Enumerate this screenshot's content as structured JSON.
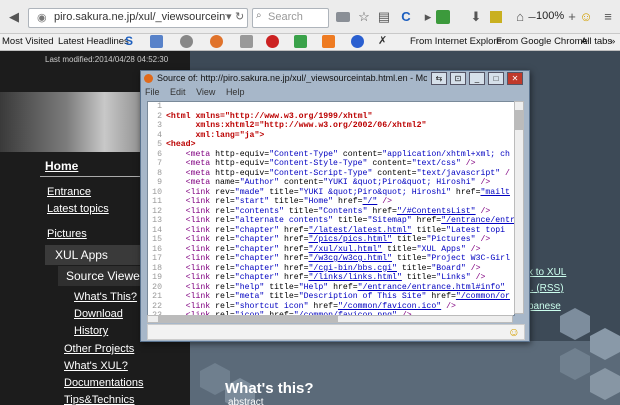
{
  "browser": {
    "url": "piro.sakura.ne.jp/xul/_viewsourceintab.html.e",
    "search_placeholder": "Search",
    "zoom": "100%",
    "bookmarks": [
      "Most Visited",
      "Latest Headlines",
      "From Internet Explorer",
      "From Google Chrome",
      "All tabs"
    ]
  },
  "site": {
    "last_modified": "Last modified:2014/04/28 04:52:30",
    "nav": {
      "home": "Home",
      "entrance": "Entrance",
      "latest_topics": "Latest topics",
      "pictures": "Pictures",
      "xul_apps": "XUL Apps",
      "source_viewer": "Source Viewer",
      "whats_this": "What's This?",
      "download": "Download",
      "history": "History",
      "other_projects": "Other Projects",
      "whats_xul": "What's XUL?",
      "documentations": "Documentations",
      "tips": "Tips&Technics"
    },
    "right_links": [
      "x to XUL",
      ".. (RSS)",
      "panese"
    ],
    "section_title": "What's this?",
    "section_sub": "abstract"
  },
  "window": {
    "title": "Source of: http://piro.sakura.ne.jp/xul/_viewsourceintab.html.en - Mozilla Firefox",
    "menu": [
      "File",
      "Edit",
      "View",
      "Help"
    ],
    "lines": [
      {
        "n": "1",
        "parts": []
      },
      {
        "n": "2",
        "parts": [
          [
            "t",
            "<html "
          ],
          [
            "a",
            "xmlns="
          ],
          [
            "v",
            "\"http://www.w3.org/1999/xhtml\""
          ]
        ]
      },
      {
        "n": "3",
        "parts": [
          [
            "a",
            "      xmlns:xhtml2="
          ],
          [
            "v",
            "\"http://www.w3.org/2002/06/xhtml2\""
          ]
        ]
      },
      {
        "n": "4",
        "parts": [
          [
            "a",
            "      xml:lang="
          ],
          [
            "v",
            "\"ja\""
          ],
          [
            "t",
            ">"
          ]
        ]
      },
      {
        "n": "5",
        "parts": [
          [
            "t",
            "<head>"
          ]
        ]
      },
      {
        "n": "6",
        "parts": [
          [
            "t",
            "    <meta "
          ],
          [
            "a",
            "http-equiv="
          ],
          [
            "v",
            "\"Content-Type\""
          ],
          [
            "a",
            " content="
          ],
          [
            "v",
            "\"application/xhtml+xml; ch"
          ]
        ]
      },
      {
        "n": "7",
        "parts": [
          [
            "t",
            "    <meta "
          ],
          [
            "a",
            "http-equiv="
          ],
          [
            "v",
            "\"Content-Style-Type\""
          ],
          [
            "a",
            " content="
          ],
          [
            "v",
            "\"text/css\""
          ],
          [
            "t",
            " />"
          ]
        ]
      },
      {
        "n": "8",
        "parts": [
          [
            "t",
            "    <meta "
          ],
          [
            "a",
            "http-equiv="
          ],
          [
            "v",
            "\"Content-Script-Type\""
          ],
          [
            "a",
            " content="
          ],
          [
            "v",
            "\"text/javascript\""
          ],
          [
            "t",
            " /"
          ]
        ]
      },
      {
        "n": "9",
        "parts": [
          [
            "t",
            "    <meta "
          ],
          [
            "a",
            "name="
          ],
          [
            "v",
            "\"Author\""
          ],
          [
            "a",
            " content="
          ],
          [
            "v",
            "\"YUKI &quot;Piro&quot; Hiroshi\""
          ],
          [
            "t",
            " />"
          ]
        ]
      },
      {
        "n": "10",
        "parts": [
          [
            "t",
            "    <link "
          ],
          [
            "a",
            "rev="
          ],
          [
            "v",
            "\"made\""
          ],
          [
            "a",
            " title="
          ],
          [
            "v",
            "\"YUKI &quot;Piro&quot; Hiroshi\""
          ],
          [
            "a",
            " href="
          ],
          [
            "l",
            "\"mailt"
          ]
        ]
      },
      {
        "n": "11",
        "parts": [
          [
            "t",
            "    <link "
          ],
          [
            "a",
            "rel="
          ],
          [
            "v",
            "\"start\""
          ],
          [
            "a",
            " title="
          ],
          [
            "v",
            "\"Home\""
          ],
          [
            "a",
            " href="
          ],
          [
            "l",
            "\"/\""
          ],
          [
            "t",
            " />"
          ]
        ]
      },
      {
        "n": "12",
        "parts": [
          [
            "t",
            "    <link "
          ],
          [
            "a",
            "rel="
          ],
          [
            "v",
            "\"contents\""
          ],
          [
            "a",
            " title="
          ],
          [
            "v",
            "\"Contents\""
          ],
          [
            "a",
            " href="
          ],
          [
            "l",
            "\"/#ContentsList\""
          ],
          [
            "t",
            " />"
          ]
        ]
      },
      {
        "n": "13",
        "parts": [
          [
            "t",
            "    <link "
          ],
          [
            "a",
            "rel="
          ],
          [
            "v",
            "\"alternate contents\""
          ],
          [
            "a",
            " title="
          ],
          [
            "v",
            "\"Sitemap\""
          ],
          [
            "a",
            " href="
          ],
          [
            "l",
            "\"/entrance/entr"
          ]
        ]
      },
      {
        "n": "14",
        "parts": [
          [
            "t",
            "    <link "
          ],
          [
            "a",
            "rel="
          ],
          [
            "v",
            "\"chapter\""
          ],
          [
            "a",
            " href="
          ],
          [
            "l",
            "\"/latest/latest.html\""
          ],
          [
            "a",
            " title="
          ],
          [
            "v",
            "\"Latest topi"
          ]
        ]
      },
      {
        "n": "15",
        "parts": [
          [
            "t",
            "    <link "
          ],
          [
            "a",
            "rel="
          ],
          [
            "v",
            "\"chapter\""
          ],
          [
            "a",
            " href="
          ],
          [
            "l",
            "\"/pics/pics.html\""
          ],
          [
            "a",
            " title="
          ],
          [
            "v",
            "\"Pictures\""
          ],
          [
            "t",
            " />"
          ]
        ]
      },
      {
        "n": "16",
        "parts": [
          [
            "t",
            "    <link "
          ],
          [
            "a",
            "rel="
          ],
          [
            "v",
            "\"chapter\""
          ],
          [
            "a",
            " href="
          ],
          [
            "l",
            "\"/xul/xul.html\""
          ],
          [
            "a",
            " title="
          ],
          [
            "v",
            "\"XUL Apps\""
          ],
          [
            "t",
            " />"
          ]
        ]
      },
      {
        "n": "17",
        "parts": [
          [
            "t",
            "    <link "
          ],
          [
            "a",
            "rel="
          ],
          [
            "v",
            "\"chapter\""
          ],
          [
            "a",
            " href="
          ],
          [
            "l",
            "\"/w3cg/w3cg.html\""
          ],
          [
            "a",
            " title="
          ],
          [
            "v",
            "\"Project W3C-Girl"
          ]
        ]
      },
      {
        "n": "18",
        "parts": [
          [
            "t",
            "    <link "
          ],
          [
            "a",
            "rel="
          ],
          [
            "v",
            "\"chapter\""
          ],
          [
            "a",
            " href="
          ],
          [
            "l",
            "\"/cgi-bin/bbs.cgi\""
          ],
          [
            "a",
            " title="
          ],
          [
            "v",
            "\"Board\""
          ],
          [
            "t",
            " />"
          ]
        ]
      },
      {
        "n": "19",
        "parts": [
          [
            "t",
            "    <link "
          ],
          [
            "a",
            "rel="
          ],
          [
            "v",
            "\"chapter\""
          ],
          [
            "a",
            " href="
          ],
          [
            "l",
            "\"/links/links.html\""
          ],
          [
            "a",
            " title="
          ],
          [
            "v",
            "\"Links\""
          ],
          [
            "t",
            " />"
          ]
        ]
      },
      {
        "n": "20",
        "parts": [
          [
            "t",
            "    <link "
          ],
          [
            "a",
            "rel="
          ],
          [
            "v",
            "\"help\""
          ],
          [
            "a",
            " title="
          ],
          [
            "v",
            "\"Help\""
          ],
          [
            "a",
            " href="
          ],
          [
            "l",
            "\"/entrance/entrance.html#info\""
          ]
        ]
      },
      {
        "n": "21",
        "parts": [
          [
            "t",
            "    <link "
          ],
          [
            "a",
            "rel="
          ],
          [
            "v",
            "\"meta\""
          ],
          [
            "a",
            " title="
          ],
          [
            "v",
            "\"Description of This Site\""
          ],
          [
            "a",
            " href="
          ],
          [
            "l",
            "\"/common/or"
          ]
        ]
      },
      {
        "n": "22",
        "parts": [
          [
            "t",
            "    <link "
          ],
          [
            "a",
            "rel="
          ],
          [
            "v",
            "\"shortcut icon\""
          ],
          [
            "a",
            " href="
          ],
          [
            "l",
            "\"/common/favicon.ico\""
          ],
          [
            "t",
            " />"
          ]
        ]
      },
      {
        "n": "23",
        "parts": [
          [
            "t",
            "    <link "
          ],
          [
            "a",
            "rel="
          ],
          [
            "v",
            "\"icon\""
          ],
          [
            "a",
            " href="
          ],
          [
            "v",
            "\"/common/favicon.png\""
          ],
          [
            "t",
            " />"
          ]
        ]
      }
    ]
  }
}
